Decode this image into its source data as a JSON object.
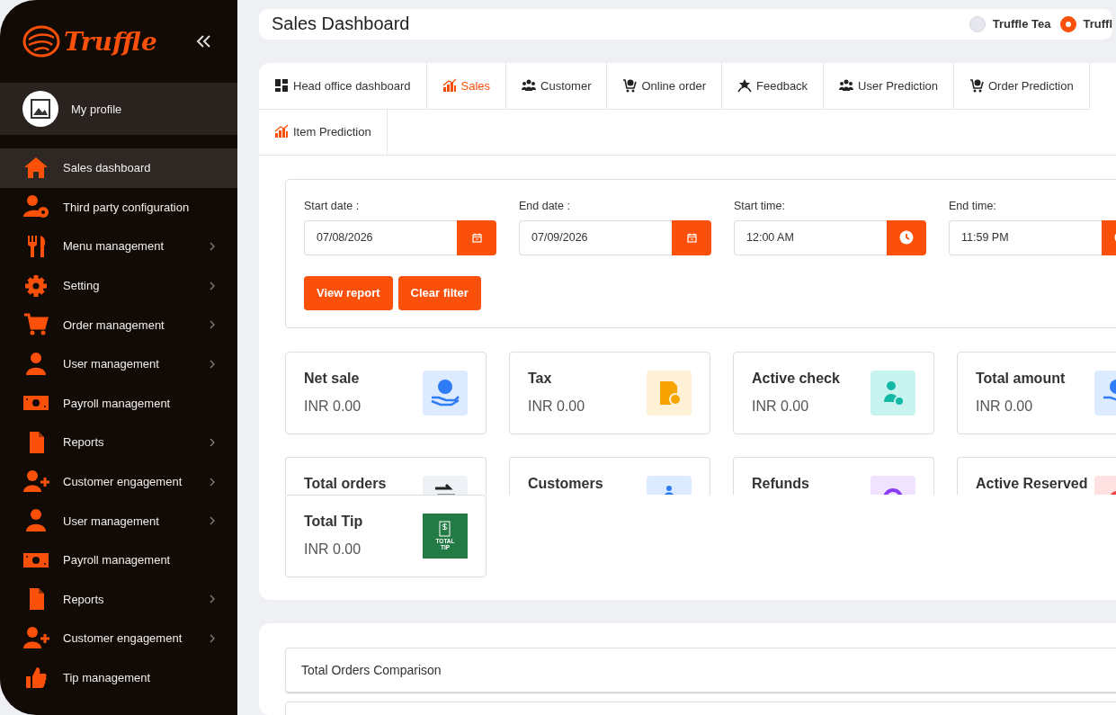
{
  "sidebar": {
    "logo": "Truffle",
    "profile": {
      "label": "My profile"
    },
    "items": [
      {
        "label": "Sales dashboard",
        "selected": true,
        "expandable": false
      },
      {
        "label": "Third party configuration",
        "selected": false,
        "expandable": false
      },
      {
        "label": "Menu management",
        "selected": false,
        "expandable": true
      },
      {
        "label": "Setting",
        "selected": false,
        "expandable": true
      },
      {
        "label": "Order management",
        "selected": false,
        "expandable": true
      },
      {
        "label": "User management",
        "selected": false,
        "expandable": true
      },
      {
        "label": "Payroll management",
        "selected": false,
        "expandable": false
      },
      {
        "label": "Reports",
        "selected": false,
        "expandable": true
      },
      {
        "label": "Customer engagement",
        "selected": false,
        "expandable": true
      },
      {
        "label": "User management",
        "selected": false,
        "expandable": true
      },
      {
        "label": "Payroll management",
        "selected": false,
        "expandable": false
      },
      {
        "label": "Reports",
        "selected": false,
        "expandable": true
      },
      {
        "label": "Customer engagement",
        "selected": false,
        "expandable": true
      },
      {
        "label": "Tip management",
        "selected": false,
        "expandable": false
      }
    ]
  },
  "header": {
    "title": "Sales Dashboard",
    "stores": [
      {
        "label": "Truffle Tea",
        "selected": false
      },
      {
        "label": "Truffl",
        "selected": true
      }
    ]
  },
  "tabs": [
    {
      "label": "Head office dashboard",
      "selected": false
    },
    {
      "label": "Sales",
      "selected": true
    },
    {
      "label": "Customer",
      "selected": false
    },
    {
      "label": "Online order",
      "selected": false
    },
    {
      "label": "Feedback",
      "selected": false
    },
    {
      "label": "User Prediction",
      "selected": false
    },
    {
      "label": "Order Prediction",
      "selected": false
    },
    {
      "label": "Item Prediction",
      "selected": false
    }
  ],
  "filters": [
    {
      "label": "Start date :",
      "value": "07/08/2026",
      "kind": "date"
    },
    {
      "label": "End date :",
      "value": "07/09/2026",
      "kind": "date"
    },
    {
      "label": "Start time:",
      "value": "12:00 AM",
      "kind": "time"
    },
    {
      "label": "End time:",
      "value": "11:59 PM",
      "kind": "time"
    }
  ],
  "buttons": [
    "View report",
    "Clear filter"
  ],
  "stats": [
    {
      "title": "Net sale",
      "value": "INR 0.00"
    },
    {
      "title": "Tax",
      "value": "INR 0.00"
    },
    {
      "title": "Active check",
      "value": "INR 0.00"
    },
    {
      "title": "Total amount",
      "value": "INR 0.00"
    }
  ],
  "stats_covered": [
    {
      "title": "Total orders"
    },
    {
      "title": "Customers"
    },
    {
      "title": "Refunds"
    },
    {
      "title": "Active Reserved"
    }
  ],
  "tip_card": {
    "title": "Total Tip",
    "value": "INR 0.00",
    "icon_label": "TOTAL TIP"
  },
  "comparison": {
    "title": "Total Orders Comparison"
  }
}
